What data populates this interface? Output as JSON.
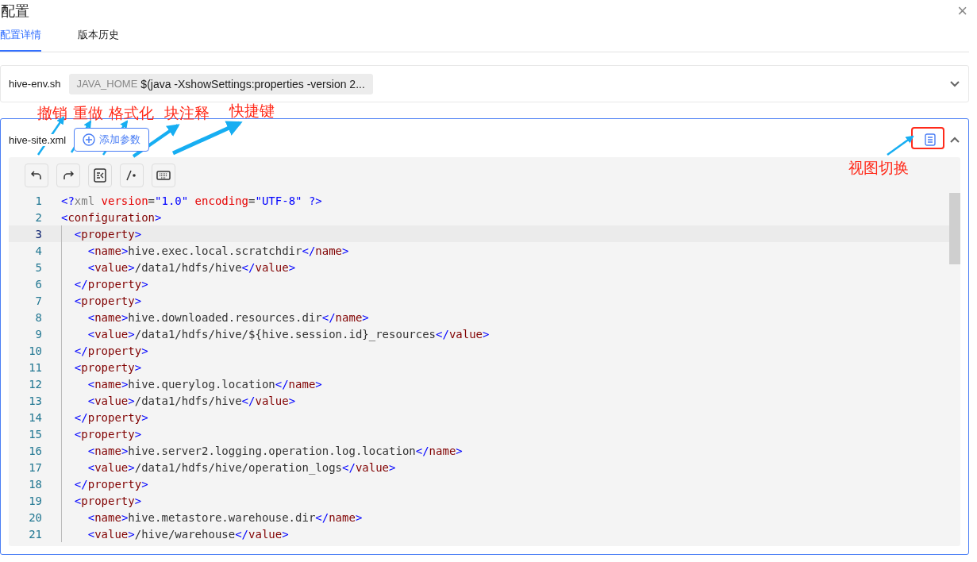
{
  "dialog": {
    "title": "配置",
    "close": "×"
  },
  "tabs": [
    {
      "label": "配置详情",
      "selected": true
    },
    {
      "label": "版本历史",
      "selected": false
    }
  ],
  "env_file": {
    "name": "hive-env.sh",
    "key": "JAVA_HOME",
    "value": "$(java -XshowSettings:properties -version 2...",
    "expanded": false
  },
  "site_file": {
    "name": "hive-site.xml",
    "add_button": "添加参数",
    "expanded": true,
    "toolbar": [
      {
        "kind": "undo"
      },
      {
        "kind": "redo"
      },
      {
        "kind": "format"
      },
      {
        "kind": "comment"
      },
      {
        "kind": "keyboard"
      }
    ],
    "lines": [
      {
        "number": "1",
        "current": false,
        "tokens": [
          {
            "kind": "p",
            "text": "<?"
          },
          {
            "kind": "m",
            "text": "xml "
          },
          {
            "kind": "a",
            "text": "version"
          },
          {
            "kind": "x",
            "text": "="
          },
          {
            "kind": "s",
            "text": "\"1.0\" "
          },
          {
            "kind": "a",
            "text": "encoding"
          },
          {
            "kind": "x",
            "text": "="
          },
          {
            "kind": "s",
            "text": "\"UTF-8\" ?>"
          }
        ]
      },
      {
        "number": "2",
        "current": false,
        "tokens": [
          {
            "kind": "p",
            "text": "<"
          },
          {
            "kind": "t",
            "text": "configuration"
          },
          {
            "kind": "p",
            "text": ">"
          }
        ]
      },
      {
        "number": "3",
        "current": true,
        "tokens": [
          {
            "kind": "p",
            "text": "  <"
          },
          {
            "kind": "t",
            "text": "property"
          },
          {
            "kind": "p",
            "text": ">"
          }
        ]
      },
      {
        "number": "4",
        "current": false,
        "tokens": [
          {
            "kind": "p",
            "text": "    <"
          },
          {
            "kind": "t",
            "text": "name"
          },
          {
            "kind": "p",
            "text": ">"
          },
          {
            "kind": "x",
            "text": "hive.exec.local.scratchdir"
          },
          {
            "kind": "p",
            "text": "</"
          },
          {
            "kind": "t",
            "text": "name"
          },
          {
            "kind": "p",
            "text": ">"
          }
        ]
      },
      {
        "number": "5",
        "current": false,
        "tokens": [
          {
            "kind": "p",
            "text": "    <"
          },
          {
            "kind": "t",
            "text": "value"
          },
          {
            "kind": "p",
            "text": ">"
          },
          {
            "kind": "x",
            "text": "/data1/hdfs/hive"
          },
          {
            "kind": "p",
            "text": "</"
          },
          {
            "kind": "t",
            "text": "value"
          },
          {
            "kind": "p",
            "text": ">"
          }
        ]
      },
      {
        "number": "6",
        "current": false,
        "tokens": [
          {
            "kind": "p",
            "text": "  </"
          },
          {
            "kind": "t",
            "text": "property"
          },
          {
            "kind": "p",
            "text": ">"
          }
        ]
      },
      {
        "number": "7",
        "current": false,
        "tokens": [
          {
            "kind": "p",
            "text": "  <"
          },
          {
            "kind": "t",
            "text": "property"
          },
          {
            "kind": "p",
            "text": ">"
          }
        ]
      },
      {
        "number": "8",
        "current": false,
        "tokens": [
          {
            "kind": "p",
            "text": "    <"
          },
          {
            "kind": "t",
            "text": "name"
          },
          {
            "kind": "p",
            "text": ">"
          },
          {
            "kind": "x",
            "text": "hive.downloaded.resources.dir"
          },
          {
            "kind": "p",
            "text": "</"
          },
          {
            "kind": "t",
            "text": "name"
          },
          {
            "kind": "p",
            "text": ">"
          }
        ]
      },
      {
        "number": "9",
        "current": false,
        "tokens": [
          {
            "kind": "p",
            "text": "    <"
          },
          {
            "kind": "t",
            "text": "value"
          },
          {
            "kind": "p",
            "text": ">"
          },
          {
            "kind": "x",
            "text": "/data1/hdfs/hive/${hive.session.id}_resources"
          },
          {
            "kind": "p",
            "text": "</"
          },
          {
            "kind": "t",
            "text": "value"
          },
          {
            "kind": "p",
            "text": ">"
          }
        ]
      },
      {
        "number": "10",
        "current": false,
        "tokens": [
          {
            "kind": "p",
            "text": "  </"
          },
          {
            "kind": "t",
            "text": "property"
          },
          {
            "kind": "p",
            "text": ">"
          }
        ]
      },
      {
        "number": "11",
        "current": false,
        "tokens": [
          {
            "kind": "p",
            "text": "  <"
          },
          {
            "kind": "t",
            "text": "property"
          },
          {
            "kind": "p",
            "text": ">"
          }
        ]
      },
      {
        "number": "12",
        "current": false,
        "tokens": [
          {
            "kind": "p",
            "text": "    <"
          },
          {
            "kind": "t",
            "text": "name"
          },
          {
            "kind": "p",
            "text": ">"
          },
          {
            "kind": "x",
            "text": "hive.querylog.location"
          },
          {
            "kind": "p",
            "text": "</"
          },
          {
            "kind": "t",
            "text": "name"
          },
          {
            "kind": "p",
            "text": ">"
          }
        ]
      },
      {
        "number": "13",
        "current": false,
        "tokens": [
          {
            "kind": "p",
            "text": "    <"
          },
          {
            "kind": "t",
            "text": "value"
          },
          {
            "kind": "p",
            "text": ">"
          },
          {
            "kind": "x",
            "text": "/data1/hdfs/hive"
          },
          {
            "kind": "p",
            "text": "</"
          },
          {
            "kind": "t",
            "text": "value"
          },
          {
            "kind": "p",
            "text": ">"
          }
        ]
      },
      {
        "number": "14",
        "current": false,
        "tokens": [
          {
            "kind": "p",
            "text": "  </"
          },
          {
            "kind": "t",
            "text": "property"
          },
          {
            "kind": "p",
            "text": ">"
          }
        ]
      },
      {
        "number": "15",
        "current": false,
        "tokens": [
          {
            "kind": "p",
            "text": "  <"
          },
          {
            "kind": "t",
            "text": "property"
          },
          {
            "kind": "p",
            "text": ">"
          }
        ]
      },
      {
        "number": "16",
        "current": false,
        "tokens": [
          {
            "kind": "p",
            "text": "    <"
          },
          {
            "kind": "t",
            "text": "name"
          },
          {
            "kind": "p",
            "text": ">"
          },
          {
            "kind": "x",
            "text": "hive.server2.logging.operation.log.location"
          },
          {
            "kind": "p",
            "text": "</"
          },
          {
            "kind": "t",
            "text": "name"
          },
          {
            "kind": "p",
            "text": ">"
          }
        ]
      },
      {
        "number": "17",
        "current": false,
        "tokens": [
          {
            "kind": "p",
            "text": "    <"
          },
          {
            "kind": "t",
            "text": "value"
          },
          {
            "kind": "p",
            "text": ">"
          },
          {
            "kind": "x",
            "text": "/data1/hdfs/hive/operation_logs"
          },
          {
            "kind": "p",
            "text": "</"
          },
          {
            "kind": "t",
            "text": "value"
          },
          {
            "kind": "p",
            "text": ">"
          }
        ]
      },
      {
        "number": "18",
        "current": false,
        "tokens": [
          {
            "kind": "p",
            "text": "  </"
          },
          {
            "kind": "t",
            "text": "property"
          },
          {
            "kind": "p",
            "text": ">"
          }
        ]
      },
      {
        "number": "19",
        "current": false,
        "tokens": [
          {
            "kind": "p",
            "text": "  <"
          },
          {
            "kind": "t",
            "text": "property"
          },
          {
            "kind": "p",
            "text": ">"
          }
        ]
      },
      {
        "number": "20",
        "current": false,
        "tokens": [
          {
            "kind": "p",
            "text": "    <"
          },
          {
            "kind": "t",
            "text": "name"
          },
          {
            "kind": "p",
            "text": ">"
          },
          {
            "kind": "x",
            "text": "hive.metastore.warehouse.dir"
          },
          {
            "kind": "p",
            "text": "</"
          },
          {
            "kind": "t",
            "text": "name"
          },
          {
            "kind": "p",
            "text": ">"
          }
        ]
      },
      {
        "number": "21",
        "current": false,
        "tokens": [
          {
            "kind": "p",
            "text": "    <"
          },
          {
            "kind": "t",
            "text": "value"
          },
          {
            "kind": "p",
            "text": ">"
          },
          {
            "kind": "x",
            "text": "/hive/warehouse"
          },
          {
            "kind": "p",
            "text": "</"
          },
          {
            "kind": "t",
            "text": "value"
          },
          {
            "kind": "p",
            "text": ">"
          }
        ]
      }
    ]
  },
  "annotations": [
    {
      "text": "撤销"
    },
    {
      "text": "重做"
    },
    {
      "text": "格式化"
    },
    {
      "text": "块注释"
    },
    {
      "text": "快捷键"
    },
    {
      "text": "视图切换"
    }
  ]
}
